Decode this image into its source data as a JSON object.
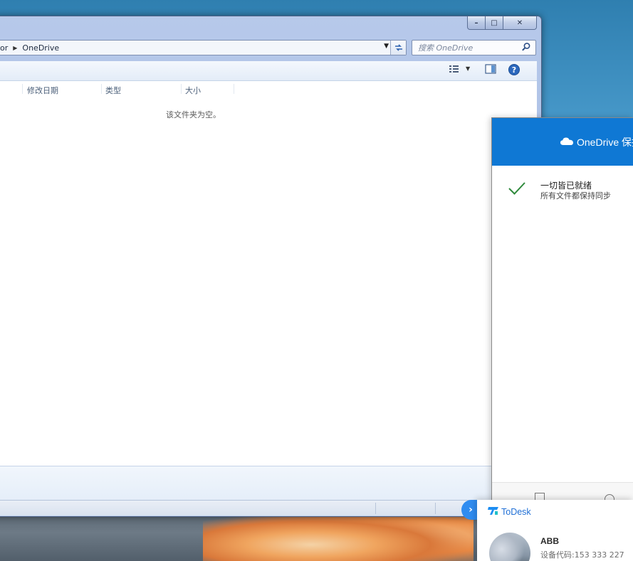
{
  "explorer": {
    "breadcrumb": [
      "or",
      "OneDrive"
    ],
    "search_placeholder": "搜索 OneDrive",
    "columns": [
      "修改日期",
      "类型",
      "大小"
    ],
    "empty_message": "该文件夹为空。",
    "caption_buttons": {
      "minimize": "–",
      "maximize": "□",
      "close": "✕"
    }
  },
  "onedrive": {
    "header_title": "OneDrive 保持",
    "status_title": "一切皆已就绪",
    "status_subtitle": "所有文件都保持同步",
    "header_color": "#0f78d4"
  },
  "todesk": {
    "app_name": "ToDesk",
    "user_name": "ABB",
    "device_code": "设备代码:153  333  227",
    "accent_color": "#2f8cf0"
  },
  "icons": [
    "view-options-icon",
    "preview-pane-icon",
    "help-icon",
    "search-icon",
    "refresh-icon",
    "onedrive-cloud-icon",
    "checkmark-icon",
    "todesk-logo-icon",
    "chevron-right-icon"
  ]
}
